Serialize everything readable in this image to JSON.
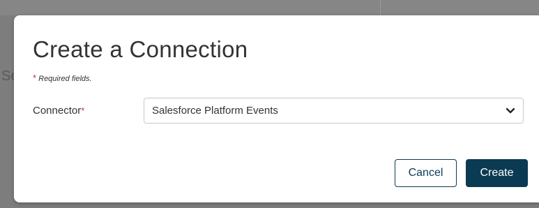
{
  "backdrop": {
    "partial_text": "Se"
  },
  "dialog": {
    "title": "Create a Connection",
    "required_asterisk": "*",
    "required_note": "Required fields."
  },
  "form": {
    "connector": {
      "label": "Connector",
      "required_mark": "*",
      "selected_value": "Salesforce Platform Events"
    }
  },
  "buttons": {
    "cancel_label": "Cancel",
    "create_label": "Create"
  },
  "colors": {
    "primary": "#0b3a53",
    "required": "#c23934",
    "overlay": "#7d7d7d"
  },
  "icons": {
    "dropdown": "chevron-down-icon"
  }
}
